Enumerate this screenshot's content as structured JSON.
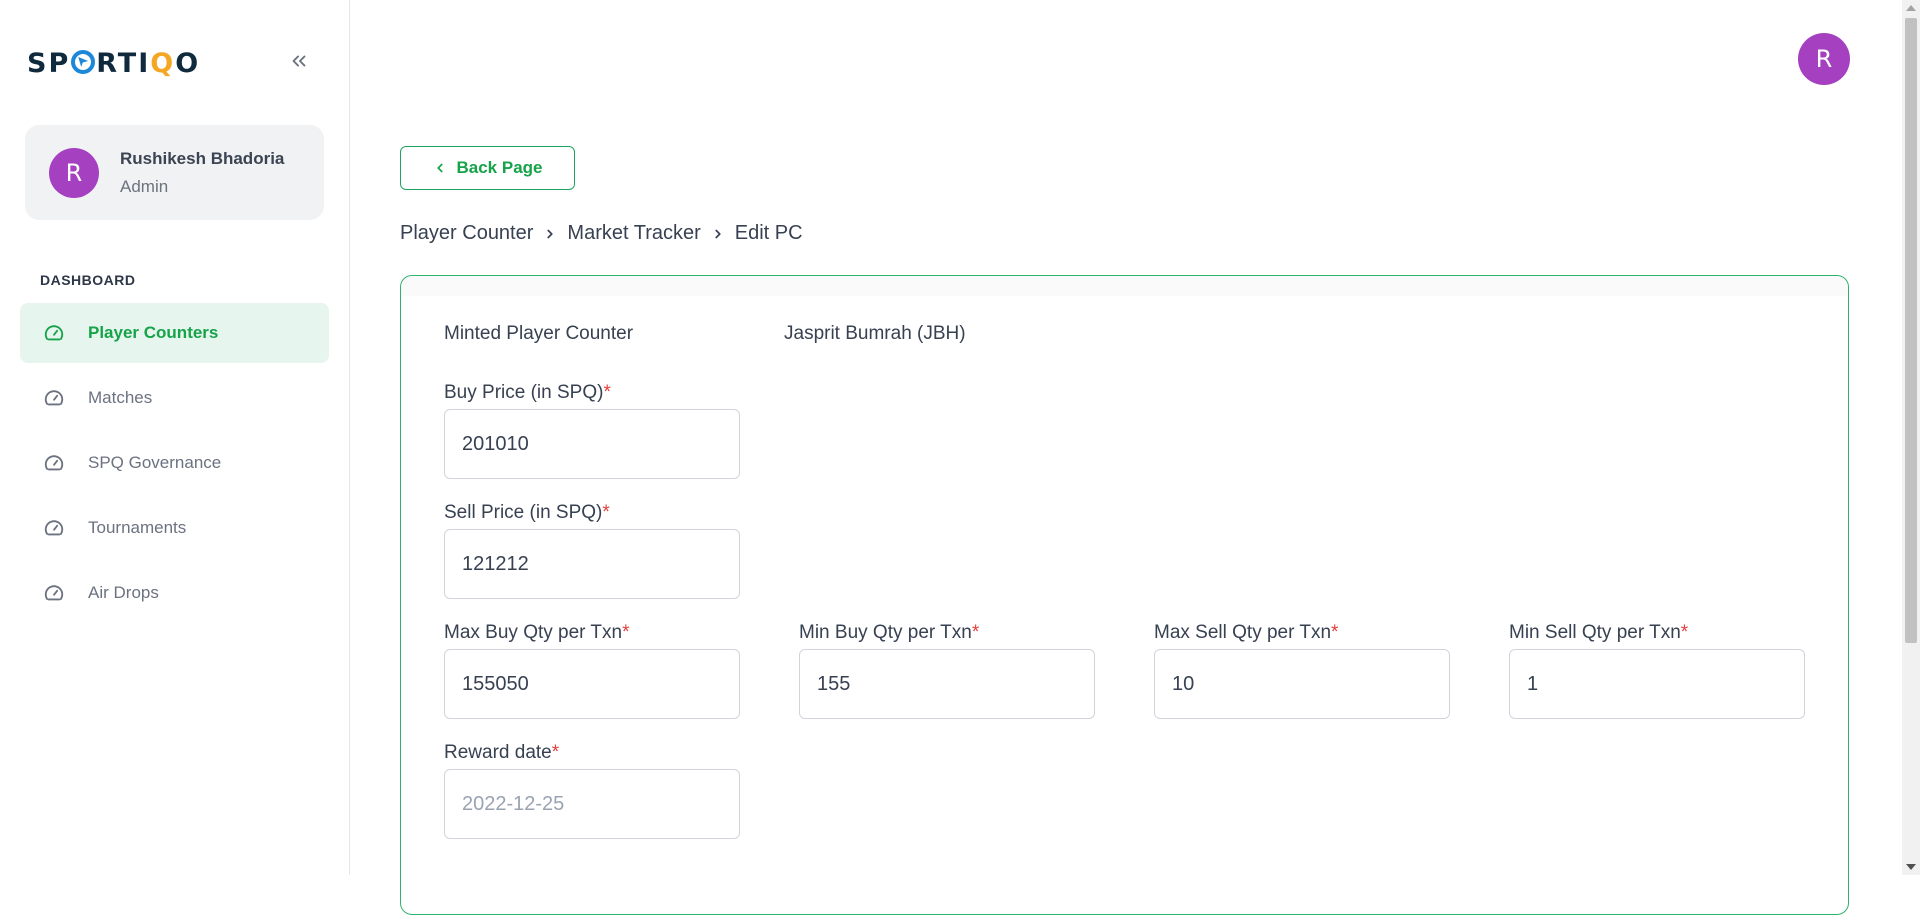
{
  "brand": {
    "part1": "SP",
    "part2": "RTI",
    "part3": "Q",
    "part4": "O"
  },
  "user": {
    "initial": "R",
    "name": "Rushikesh Bhadoria",
    "role": "Admin"
  },
  "sidebar": {
    "section_title": "DASHBOARD",
    "items": [
      {
        "label": "Player Counters",
        "icon": "dashboard-gauge-icon",
        "active": true
      },
      {
        "label": "Matches",
        "icon": "dashboard-gauge-icon",
        "active": false
      },
      {
        "label": "SPQ Governance",
        "icon": "dashboard-gauge-icon",
        "active": false
      },
      {
        "label": "Tournaments",
        "icon": "dashboard-gauge-icon",
        "active": false
      },
      {
        "label": "Air Drops",
        "icon": "dashboard-gauge-icon",
        "active": false
      }
    ]
  },
  "header": {
    "avatar_initial": "R"
  },
  "back_button": {
    "label": "Back Page"
  },
  "breadcrumb": [
    "Player Counter",
    "Market Tracker",
    "Edit PC"
  ],
  "form": {
    "info_label": "Minted Player Counter",
    "info_value": "Jasprit Bumrah (JBH)",
    "required_mark": "*",
    "buy_price": {
      "label": "Buy Price (in SPQ)",
      "value": "201010"
    },
    "sell_price": {
      "label": "Sell Price (in SPQ)",
      "value": "121212"
    },
    "max_buy_qty": {
      "label": "Max Buy Qty per Txn",
      "value": "155050"
    },
    "min_buy_qty": {
      "label": "Min Buy Qty per Txn",
      "value": "155"
    },
    "max_sell_qty": {
      "label": "Max Sell Qty per Txn",
      "value": "10"
    },
    "min_sell_qty": {
      "label": "Min Sell Qty per Txn",
      "value": "1"
    },
    "reward_date": {
      "label": "Reward date",
      "value": "",
      "placeholder": "2022-12-25"
    }
  },
  "colors": {
    "accent": "#16a34a",
    "avatar": "#a540c0",
    "required": "#e53e3e",
    "brand_dark": "#0f2a3d",
    "brand_blue": "#1e88d8",
    "brand_orange": "#f5a623"
  }
}
